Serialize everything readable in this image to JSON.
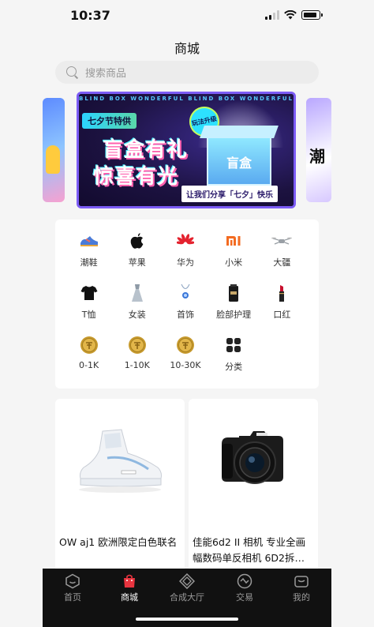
{
  "status_bar": {
    "time": "10:37"
  },
  "header": {
    "title": "商城"
  },
  "search": {
    "placeholder": "搜索商品"
  },
  "banner": {
    "edge_text": "BLIND BOX WONDERFUL BLIND BOX WONDERFUL BLIND BOX WONDERFUL",
    "tag": "七夕节特供",
    "badge": "玩法升级",
    "title_line1": "盲盒有礼",
    "title_line2": "惊喜有光",
    "box_label": "盲盒",
    "slogan": "让我们分享「七夕」快乐"
  },
  "categories": [
    {
      "label": "潮鞋",
      "icon": "sneaker-icon"
    },
    {
      "label": "苹果",
      "icon": "apple-logo-icon"
    },
    {
      "label": "华为",
      "icon": "huawei-logo-icon"
    },
    {
      "label": "小米",
      "icon": "xiaomi-logo-icon"
    },
    {
      "label": "大疆",
      "icon": "drone-icon"
    },
    {
      "label": "T恤",
      "icon": "tshirt-icon"
    },
    {
      "label": "女装",
      "icon": "dress-icon"
    },
    {
      "label": "首饰",
      "icon": "necklace-icon"
    },
    {
      "label": "脸部护理",
      "icon": "skincare-icon"
    },
    {
      "label": "口红",
      "icon": "lipstick-icon"
    },
    {
      "label": "0-1K",
      "icon": "coin-icon"
    },
    {
      "label": "1-10K",
      "icon": "coin-icon"
    },
    {
      "label": "10-30K",
      "icon": "coin-icon"
    },
    {
      "label": "分类",
      "icon": "grid-icon"
    }
  ],
  "products": [
    {
      "title": "OW aj1 欧洲限定白色联名",
      "icon": "sneaker-image"
    },
    {
      "title": "佳能6d2 II 相机 专业全画幅数码单反相机 6D2拆…",
      "icon": "camera-image"
    }
  ],
  "tabs": [
    {
      "label": "首页",
      "icon": "home-icon"
    },
    {
      "label": "商城",
      "icon": "shopping-bag-icon",
      "active": true
    },
    {
      "label": "合成大厅",
      "icon": "diamond-icon"
    },
    {
      "label": "交易",
      "icon": "exchange-icon"
    },
    {
      "label": "我的",
      "icon": "profile-icon"
    }
  ],
  "colors": {
    "accent": "#e8343f",
    "tab_bar": "#111111",
    "banner_border": "#7c5cf5"
  }
}
